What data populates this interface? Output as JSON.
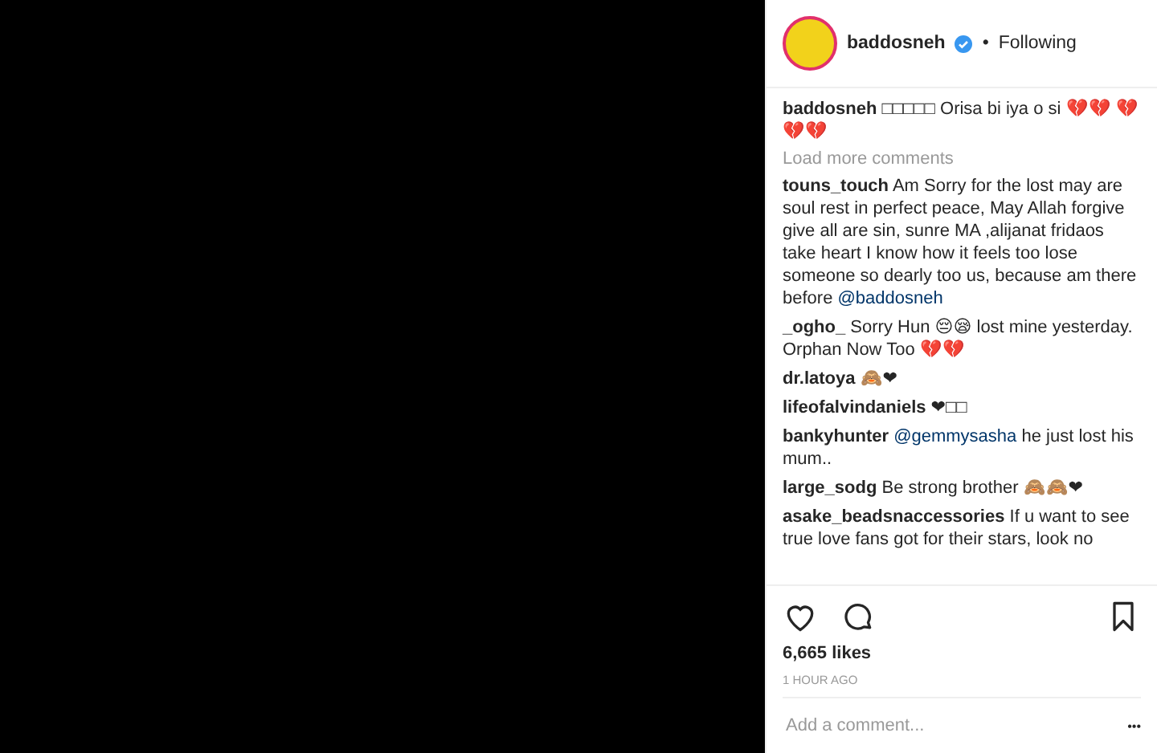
{
  "post": {
    "author": {
      "username": "baddosneh",
      "verified": true,
      "separator": "•",
      "follow_state": "Following"
    },
    "caption": {
      "username": "baddosneh",
      "text": "□□□□□ Orisa bi iya o si 💔💔 💔💔💔"
    },
    "load_more": "Load more comments",
    "comments": [
      {
        "username": "touns_touch",
        "text": "Am Sorry for the lost may are soul rest in perfect peace, May Allah forgive give all are sin, sunre MA ,alijanat fridaos take heart I know how it feels too lose someone so dearly too us, because am there before",
        "mention": "@baddosneh"
      },
      {
        "username": "_ogho_",
        "text": "Sorry Hun 😔😪 lost mine yesterday. Orphan Now Too 💔💔"
      },
      {
        "username": "dr.latoya",
        "text": "🙈❤"
      },
      {
        "username": "lifeofalvindaniels",
        "text": "❤□□"
      },
      {
        "username": "bankyhunter",
        "mention": "@gemmysasha",
        "after": "he just lost his mum.."
      },
      {
        "username": "large_sodg",
        "text": "Be strong brother 🙈🙈❤"
      },
      {
        "username": "asake_beadsnaccessories",
        "text": "If u want to see true love fans got for their stars, look no"
      }
    ],
    "liked": false,
    "saved": false,
    "likes": "6,665 likes",
    "time": "1 HOUR AGO",
    "comment_placeholder": "Add a comment...",
    "more": "•••"
  }
}
